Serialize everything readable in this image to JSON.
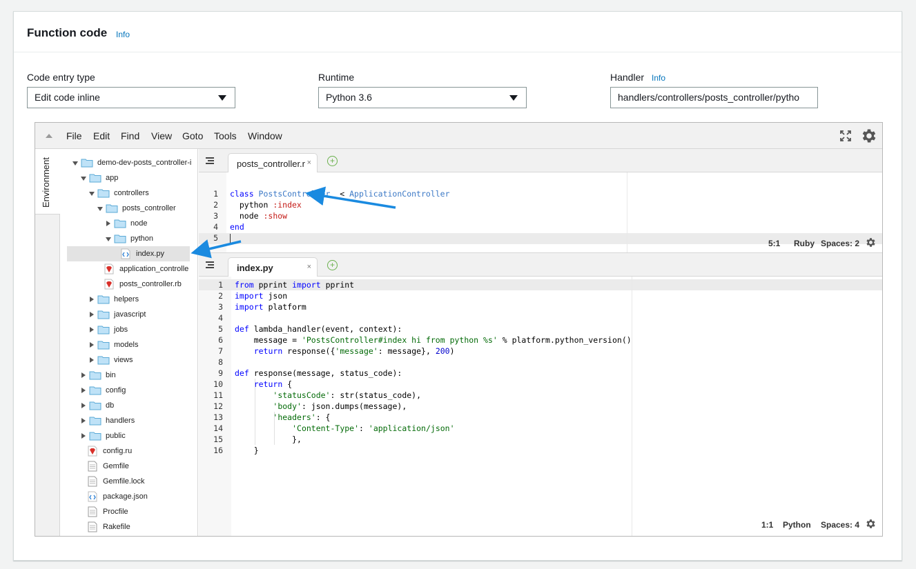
{
  "section": {
    "title": "Function code",
    "info": "Info"
  },
  "fields": {
    "code_entry": {
      "label": "Code entry type",
      "value": "Edit code inline"
    },
    "runtime": {
      "label": "Runtime",
      "value": "Python 3.6"
    },
    "handler": {
      "label": "Handler",
      "info": "Info",
      "value": "handlers/controllers/posts_controller/pytho"
    }
  },
  "ide": {
    "menu": [
      "File",
      "Edit",
      "Find",
      "View",
      "Goto",
      "Tools",
      "Window"
    ],
    "environment_tab": "Environment",
    "tree": [
      {
        "label": "demo-dev-posts_controller-i",
        "type": "folder",
        "depth": 0,
        "state": "open"
      },
      {
        "label": "app",
        "type": "folder",
        "depth": 1,
        "state": "open"
      },
      {
        "label": "controllers",
        "type": "folder",
        "depth": 2,
        "state": "open"
      },
      {
        "label": "posts_controller",
        "type": "folder",
        "depth": 3,
        "state": "open"
      },
      {
        "label": "node",
        "type": "folder",
        "depth": 4,
        "state": "closed"
      },
      {
        "label": "python",
        "type": "folder",
        "depth": 4,
        "state": "open"
      },
      {
        "label": "index.py",
        "type": "code",
        "depth": 5,
        "state": "selected"
      },
      {
        "label": "application_controlle",
        "type": "ruby",
        "depth": 3,
        "state": ""
      },
      {
        "label": "posts_controller.rb",
        "type": "ruby",
        "depth": 3,
        "state": ""
      },
      {
        "label": "helpers",
        "type": "folder",
        "depth": 2,
        "state": "closed"
      },
      {
        "label": "javascript",
        "type": "folder",
        "depth": 2,
        "state": "closed"
      },
      {
        "label": "jobs",
        "type": "folder",
        "depth": 2,
        "state": "closed"
      },
      {
        "label": "models",
        "type": "folder",
        "depth": 2,
        "state": "closed"
      },
      {
        "label": "views",
        "type": "folder",
        "depth": 2,
        "state": "closed"
      },
      {
        "label": "bin",
        "type": "folder",
        "depth": 1,
        "state": "closed"
      },
      {
        "label": "config",
        "type": "folder",
        "depth": 1,
        "state": "closed"
      },
      {
        "label": "db",
        "type": "folder",
        "depth": 1,
        "state": "closed"
      },
      {
        "label": "handlers",
        "type": "folder",
        "depth": 1,
        "state": "closed"
      },
      {
        "label": "public",
        "type": "folder",
        "depth": 1,
        "state": "closed"
      },
      {
        "label": "config.ru",
        "type": "ruby",
        "depth": 1,
        "state": ""
      },
      {
        "label": "Gemfile",
        "type": "doc",
        "depth": 1,
        "state": ""
      },
      {
        "label": "Gemfile.lock",
        "type": "doc",
        "depth": 1,
        "state": ""
      },
      {
        "label": "package.json",
        "type": "code",
        "depth": 1,
        "state": ""
      },
      {
        "label": "Procfile",
        "type": "doc",
        "depth": 1,
        "state": ""
      },
      {
        "label": "Rakefile",
        "type": "doc",
        "depth": 1,
        "state": ""
      }
    ],
    "editor_top": {
      "tab": "posts_controller.r",
      "close": "×",
      "add": "+",
      "lines": [
        [
          [
            "kw",
            "class "
          ],
          [
            "cls",
            "PostsController"
          ],
          [
            "",
            "  < "
          ],
          [
            "cls",
            "ApplicationController"
          ]
        ],
        [
          [
            "",
            "  python "
          ],
          [
            "sym",
            ":index"
          ]
        ],
        [
          [
            "",
            "  node "
          ],
          [
            "sym",
            ":show"
          ]
        ],
        [
          [
            "kw",
            "end"
          ]
        ],
        [
          [
            "",
            ""
          ]
        ]
      ],
      "line_numbers": [
        "1",
        "2",
        "3",
        "4",
        "5"
      ],
      "status": {
        "position": "5:1",
        "mode": "Ruby",
        "spaces": "Spaces: 2"
      }
    },
    "editor_bottom": {
      "tab": "index.py",
      "close": "×",
      "add": "+",
      "lines": [
        [
          [
            "kw",
            "from"
          ],
          [
            "",
            " pprint "
          ],
          [
            "kw",
            "import"
          ],
          [
            "",
            " pprint"
          ]
        ],
        [
          [
            "kw",
            "import"
          ],
          [
            "",
            " json"
          ]
        ],
        [
          [
            "kw",
            "import"
          ],
          [
            "",
            " platform"
          ]
        ],
        [
          [
            "",
            ""
          ]
        ],
        [
          [
            "kw",
            "def"
          ],
          [
            "",
            " lambda_handler(event, context):"
          ]
        ],
        [
          [
            "",
            "    message = "
          ],
          [
            "str",
            "'PostsController#index hi from python %s'"
          ],
          [
            "",
            " % platform.python_version()"
          ]
        ],
        [
          [
            "",
            "    "
          ],
          [
            "kw",
            "return"
          ],
          [
            "",
            " response({"
          ],
          [
            "str",
            "'message'"
          ],
          [
            "",
            ": message}, "
          ],
          [
            "num",
            "200"
          ],
          [
            "",
            ")"
          ]
        ],
        [
          [
            "",
            ""
          ]
        ],
        [
          [
            "kw",
            "def"
          ],
          [
            "",
            " response(message, status_code):"
          ]
        ],
        [
          [
            "",
            "    "
          ],
          [
            "kw",
            "return"
          ],
          [
            "",
            " {"
          ]
        ],
        [
          [
            "",
            "        "
          ],
          [
            "str",
            "'statusCode'"
          ],
          [
            "",
            ": str(status_code),"
          ]
        ],
        [
          [
            "",
            "        "
          ],
          [
            "str",
            "'body'"
          ],
          [
            "",
            ": json.dumps(message),"
          ]
        ],
        [
          [
            "",
            "        "
          ],
          [
            "str",
            "'headers'"
          ],
          [
            "",
            ": {"
          ]
        ],
        [
          [
            "",
            "            "
          ],
          [
            "str",
            "'Content-Type'"
          ],
          [
            "",
            ": "
          ],
          [
            "str",
            "'application/json'"
          ]
        ],
        [
          [
            "",
            "            },"
          ]
        ],
        [
          [
            "",
            "    }"
          ]
        ]
      ],
      "line_numbers": [
        "1",
        "2",
        "3",
        "4",
        "5",
        "6",
        "7",
        "8",
        "9",
        "10",
        "11",
        "12",
        "13",
        "14",
        "15",
        "16"
      ],
      "status": {
        "position": "1:1",
        "mode": "Python",
        "spaces": "Spaces: 4"
      }
    }
  },
  "colors": {
    "accent": "#0073bb",
    "annotation_arrow": "#1a8ae0"
  },
  "icons": [
    "fullscreen-icon",
    "gear-icon",
    "folder-icon",
    "ruby-file-icon",
    "code-file-icon",
    "document-icon"
  ]
}
